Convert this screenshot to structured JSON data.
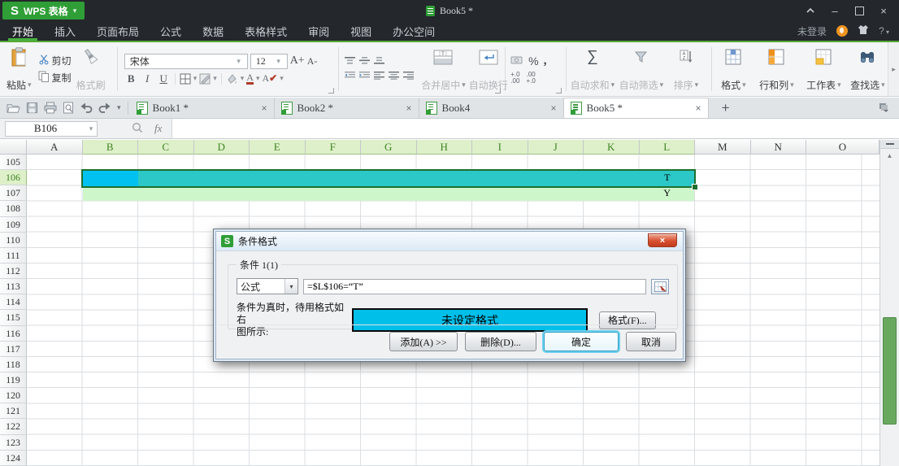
{
  "titlebar": {
    "logo_letter": "S",
    "app_button": "WPS 表格",
    "doc_title": "Book5 *"
  },
  "menu": {
    "items": [
      "开始",
      "插入",
      "页面布局",
      "公式",
      "数据",
      "表格样式",
      "审阅",
      "视图",
      "办公空间"
    ],
    "active": "开始",
    "right": {
      "login": "未登录"
    }
  },
  "icons": {
    "chevron_down": "▾",
    "close": "×",
    "plus": "+",
    "sum": "∑",
    "scroll_up": "▲",
    "ribbon_expand": "▸",
    "minimize": "–",
    "percent": "%",
    "comma": ",",
    "bold": "B",
    "italic": "I",
    "underline": "U",
    "a_grow": "A+",
    "a_shrink": "A-",
    "dec_inc_top": "+.0",
    "dec_inc_bot": ".00",
    "dec_dec_top": ".00",
    "dec_dec_bot": "+.0",
    "help": "?"
  },
  "ribbon": {
    "paste": "粘贴",
    "cut": "剪切",
    "copy": "复制",
    "format_painter": "格式刷",
    "font_name": "宋体",
    "font_size": "12",
    "merge_center": "合并居中",
    "wrap_text": "自动换行",
    "autosum": "自动求和",
    "autofilter": "自动筛选",
    "sort": "排序",
    "format": "格式",
    "rows_columns": "行和列",
    "worksheet": "工作表",
    "find_select": "查找选"
  },
  "doc_tabs": [
    {
      "label": "Book1 *",
      "active": false
    },
    {
      "label": "Book2 *",
      "active": false
    },
    {
      "label": "Book4",
      "active": false
    },
    {
      "label": "Book5 *",
      "active": true
    }
  ],
  "formula_bar": {
    "name_box": "B106",
    "fx_label": "fx",
    "formula": ""
  },
  "sheet": {
    "first_row": 105,
    "columns": [
      {
        "l": "A",
        "hl": false
      },
      {
        "l": "B",
        "hl": true
      },
      {
        "l": "C",
        "hl": true
      },
      {
        "l": "D",
        "hl": true
      },
      {
        "l": "E",
        "hl": true
      },
      {
        "l": "F",
        "hl": true
      },
      {
        "l": "G",
        "hl": true
      },
      {
        "l": "H",
        "hl": true
      },
      {
        "l": "I",
        "hl": true
      },
      {
        "l": "J",
        "hl": true
      },
      {
        "l": "K",
        "hl": true
      },
      {
        "l": "L",
        "hl": true
      },
      {
        "l": "M",
        "hl": false
      },
      {
        "l": "N",
        "hl": false
      },
      {
        "l": "O",
        "hl": false
      }
    ],
    "rows": [
      {
        "n": "105",
        "hl": false
      },
      {
        "n": "106",
        "hl": true
      },
      {
        "n": "107",
        "hl": false
      },
      {
        "n": "108",
        "hl": false
      },
      {
        "n": "109",
        "hl": false
      },
      {
        "n": "110",
        "hl": false
      },
      {
        "n": "111",
        "hl": false
      },
      {
        "n": "112",
        "hl": false
      },
      {
        "n": "113",
        "hl": false
      },
      {
        "n": "114",
        "hl": false
      },
      {
        "n": "115",
        "hl": false
      },
      {
        "n": "116",
        "hl": false
      },
      {
        "n": "117",
        "hl": false
      },
      {
        "n": "118",
        "hl": false
      },
      {
        "n": "119",
        "hl": false
      },
      {
        "n": "120",
        "hl": false
      },
      {
        "n": "121",
        "hl": false
      },
      {
        "n": "122",
        "hl": false
      },
      {
        "n": "123",
        "hl": false
      },
      {
        "n": "124",
        "hl": false
      }
    ],
    "cells": [
      {
        "col": "L",
        "row": 106,
        "value": "T"
      },
      {
        "col": "L",
        "row": 107,
        "value": "Y"
      }
    ],
    "colors": {
      "active_cell": "#00c1ef",
      "selection_fill": "#2cc7c7",
      "selection_border": "#1e6f2f",
      "conditional_fill": "#cdf6cb",
      "scrollbar_thumb": "#69a85f"
    }
  },
  "dialog": {
    "title": "条件格式",
    "group_label": "条件 1(1)",
    "type_dropdown": "公式",
    "formula": "=$L$106=“T”",
    "condition_label_line1": "条件为真时，待用格式如右",
    "condition_label_line2": "图所示:",
    "preview_text": "未设定格式",
    "preview_fill": "#00bfe9",
    "format_button": "格式(F)...",
    "add_button": "添加(A) >>",
    "delete_button": "删除(D)...",
    "ok_button": "确定",
    "cancel_button": "取消"
  }
}
